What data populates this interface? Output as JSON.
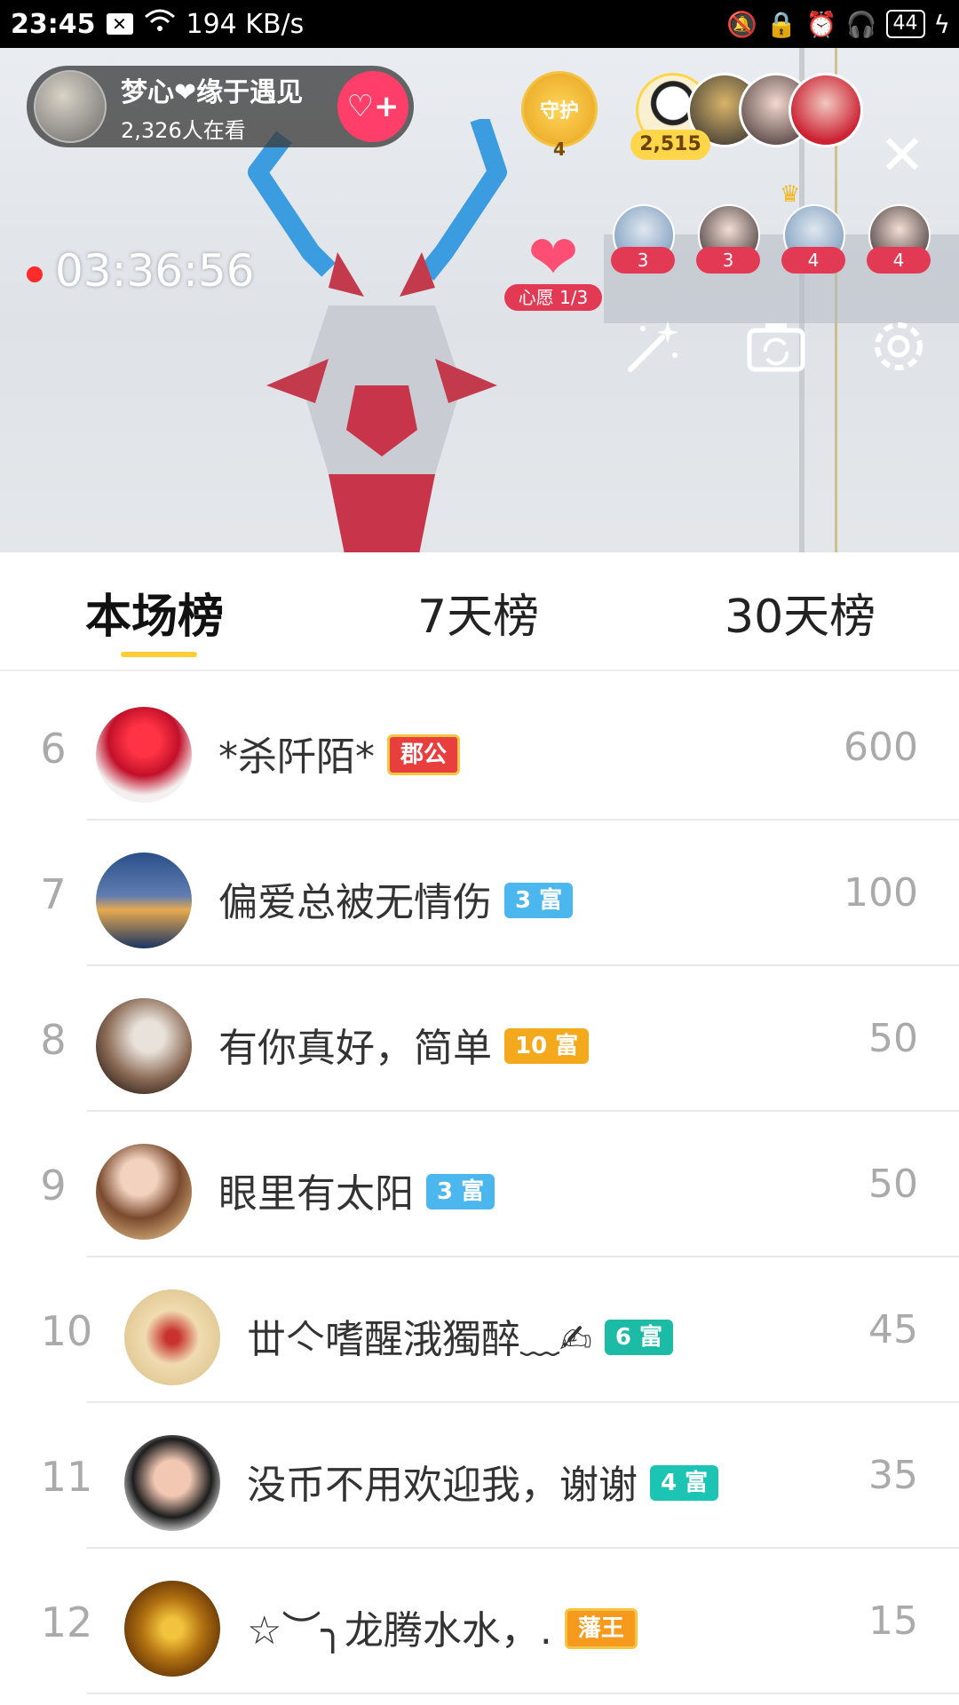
{
  "status_bar": {
    "time": "23:45",
    "notif_badge": "✕",
    "network_speed": "194 KB/s",
    "battery": "44"
  },
  "host": {
    "name": "梦心❤缘于遇见",
    "viewers": "2,326人在看",
    "follow_icon": "♡+"
  },
  "guard": {
    "label": "守护",
    "count": "4"
  },
  "fans": {
    "score": "2,515"
  },
  "live": {
    "timer": "03:36:56"
  },
  "wish": {
    "label": "心愿 1/3"
  },
  "mic_users": [
    {
      "count": "3"
    },
    {
      "count": "3"
    },
    {
      "count": "4"
    },
    {
      "count": "4"
    }
  ],
  "tabs": [
    {
      "label": "本场榜"
    },
    {
      "label": "7天榜"
    },
    {
      "label": "30天榜"
    }
  ],
  "rank_list": [
    {
      "rank": "6",
      "name": "*杀阡陌*",
      "badge": "郡公",
      "badge_color": "#e83e3e",
      "score": "600"
    },
    {
      "rank": "7",
      "name": "偏爱总被无情伤",
      "badge": "3 富",
      "badge_color": "#4cb6ee",
      "score": "100"
    },
    {
      "rank": "8",
      "name": "有你真好，简单",
      "badge": "10 富",
      "badge_color": "#f4a81c",
      "score": "50"
    },
    {
      "rank": "9",
      "name": "眼里有太阳",
      "badge": "3 富",
      "badge_color": "#4cb6ee",
      "score": "50"
    },
    {
      "rank": "10",
      "name": "丗亽嗜醒涐獨醉﹏✍",
      "badge": "6 富",
      "badge_color": "#1cbba6",
      "score": "45"
    },
    {
      "rank": "11",
      "name": "没币不用欢迎我，谢谢",
      "badge": "4 富",
      "badge_color": "#1cc4b4",
      "score": "35"
    },
    {
      "rank": "12",
      "name": "☆︶╮龙腾水水，.",
      "badge": "藩王",
      "badge_color": "#f59a1d",
      "score": "15"
    }
  ]
}
